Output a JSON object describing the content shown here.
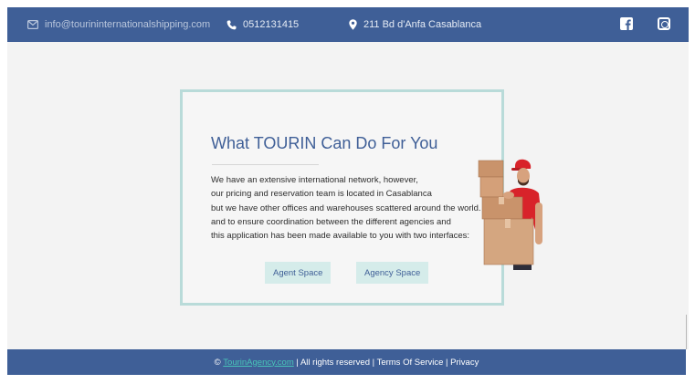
{
  "topbar": {
    "email": "info@tourininternationalshipping.com",
    "phone": "0512131415",
    "address": "211 Bd d'Anfa Casablanca",
    "social": [
      "facebook-icon",
      "instagram-icon"
    ]
  },
  "card": {
    "title": "What TOURIN Can Do For You",
    "lines": [
      "We have an extensive international network, however,",
      "our pricing and reservation team is located in Casablanca",
      "but we have other offices and warehouses scattered around the world.",
      "and to ensure coordination between the different agencies and",
      "this application has been made available to you with two interfaces:"
    ],
    "buttons": {
      "agent": "Agent Space",
      "agency": "Agency Space"
    }
  },
  "footer": {
    "copyright": "©",
    "link": "TourinAgency.com",
    "rest": "| All rights reserved | Terms Of Service | Privacy"
  },
  "colors": {
    "brand": "#3f5f97",
    "accent": "#48c5b8",
    "card_border": "#b9dbd9",
    "button_bg": "#d5ecea"
  }
}
